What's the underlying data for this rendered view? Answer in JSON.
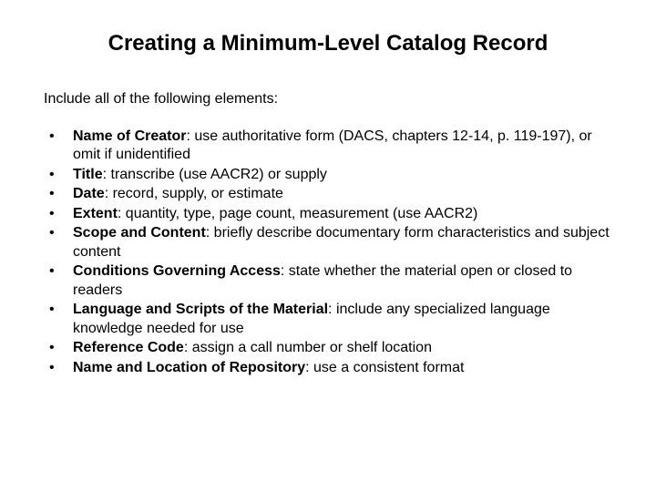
{
  "title": "Creating a Minimum-Level Catalog Record",
  "intro": "Include all of the following elements:",
  "items": [
    {
      "label": "Name of Creator",
      "desc": ": use authoritative form (DACS, chapters 12-14, p. 119-197), or omit if unidentified"
    },
    {
      "label": "Title",
      "desc": ": transcribe (use AACR2) or supply"
    },
    {
      "label": "Date",
      "desc": ": record, supply, or estimate"
    },
    {
      "label": "Extent",
      "desc": ": quantity, type, page count, measurement (use AACR2)"
    },
    {
      "label": "Scope and Content",
      "desc": ": briefly describe documentary form characteristics and subject content"
    },
    {
      "label": "Conditions Governing Access",
      "desc": ": state whether the material open or closed to readers"
    },
    {
      "label": "Language and Scripts of the Material",
      "desc": ": include any specialized language knowledge needed for use"
    },
    {
      "label": "Reference Code",
      "desc": ": assign a call number or shelf location"
    },
    {
      "label": "Name and Location of Repository",
      "desc": ": use a consistent format"
    }
  ]
}
